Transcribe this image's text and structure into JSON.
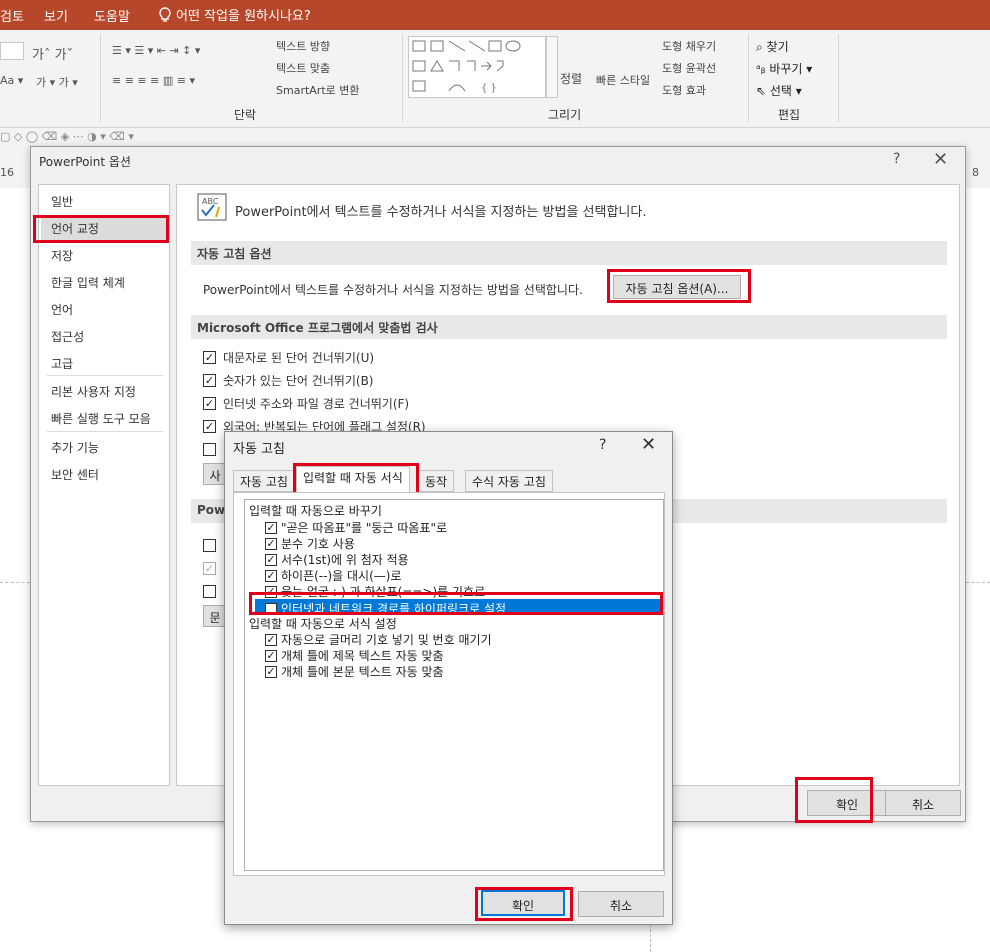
{
  "menubar": {
    "review": "검토",
    "view": "보기",
    "help": "도움말",
    "tell_me": "어떤 작업을 원하시나요?"
  },
  "ribbon": {
    "paragraph": {
      "label": "단락",
      "text_direction": "텍스트 방향",
      "align_text": "텍스트 맞춤",
      "smartart": "SmartArt로 변환"
    },
    "drawing": {
      "label": "그리기",
      "arrange": "정렬",
      "quick_styles": "빠른 스타일",
      "shape_fill": "도형 채우기",
      "shape_outline": "도형 윤곽선",
      "shape_effects": "도형 효과"
    },
    "editing": {
      "label": "편집",
      "find": "찾기",
      "replace": "바꾸기",
      "select": "선택"
    }
  },
  "ruler": {
    "left_num": "16",
    "right_num": "8"
  },
  "options_dialog": {
    "title": "PowerPoint 옵션",
    "help": "?",
    "close": "✕",
    "nav": [
      "일반",
      "언어 교정",
      "저장",
      "한글 입력 체계",
      "언어",
      "접근성",
      "고급",
      "리본 사용자 지정",
      "빠른 실행 도구 모음",
      "추가 기능",
      "보안 센터"
    ],
    "header_text": "PowerPoint에서 텍스트를 수정하거나 서식을 지정하는 방법을 선택합니다.",
    "autocorrect_section": "자동 고침 옵션",
    "autocorrect_desc": "PowerPoint에서 텍스트를 수정하거나 서식을 지정하는 방법을 선택합니다.",
    "autocorrect_button": "자동 고침 옵션(A)...",
    "spelling_section": "Microsoft Office 프로그램에서 맞춤법 검사",
    "spelling_items": [
      "대문자로 된 단어 건너뛰기(U)",
      "숫자가 있는 단어 건너뛰기(B)",
      "인터넷 주소와 파일 경로 건너뛰기(F)",
      "외국어: 반복되는 단어에 플래그 설정(R)"
    ],
    "partial_button": "사",
    "partial_section": "Powe",
    "partial_button2": "문",
    "ok": "확인",
    "cancel": "취소"
  },
  "autocorrect_dialog": {
    "title": "자동 고침",
    "help": "?",
    "close": "✕",
    "tabs": [
      "자동 고침",
      "입력할 때 자동 서식",
      "동작",
      "수식 자동 고침"
    ],
    "group1": "입력할 때 자동으로 바꾸기",
    "group1_items": [
      "\"곧은 따옴표\"를 \"둥근 따옴표\"로",
      "분수 기호 사용",
      "서수(1st)에 위 첨자 적용",
      "하이픈(--)을 대시(—)로",
      "웃는 얼굴 :-) 과 화살표(==>)를 기호로",
      "인터넷과 네트워크 경로를 하이퍼링크로 설정"
    ],
    "group2": "입력할 때 자동으로 서식 설정",
    "group2_items": [
      "자동으로 글머리 기호 넣기 및 번호 매기기",
      "개체 틀에 제목 텍스트 자동 맞춤",
      "개체 틀에 본문 텍스트 자동 맞춤"
    ],
    "ok": "확인",
    "cancel": "취소"
  },
  "colors": {
    "accent": "#b7472a",
    "highlight": "#0078d7",
    "annotation": "#e0001a"
  }
}
